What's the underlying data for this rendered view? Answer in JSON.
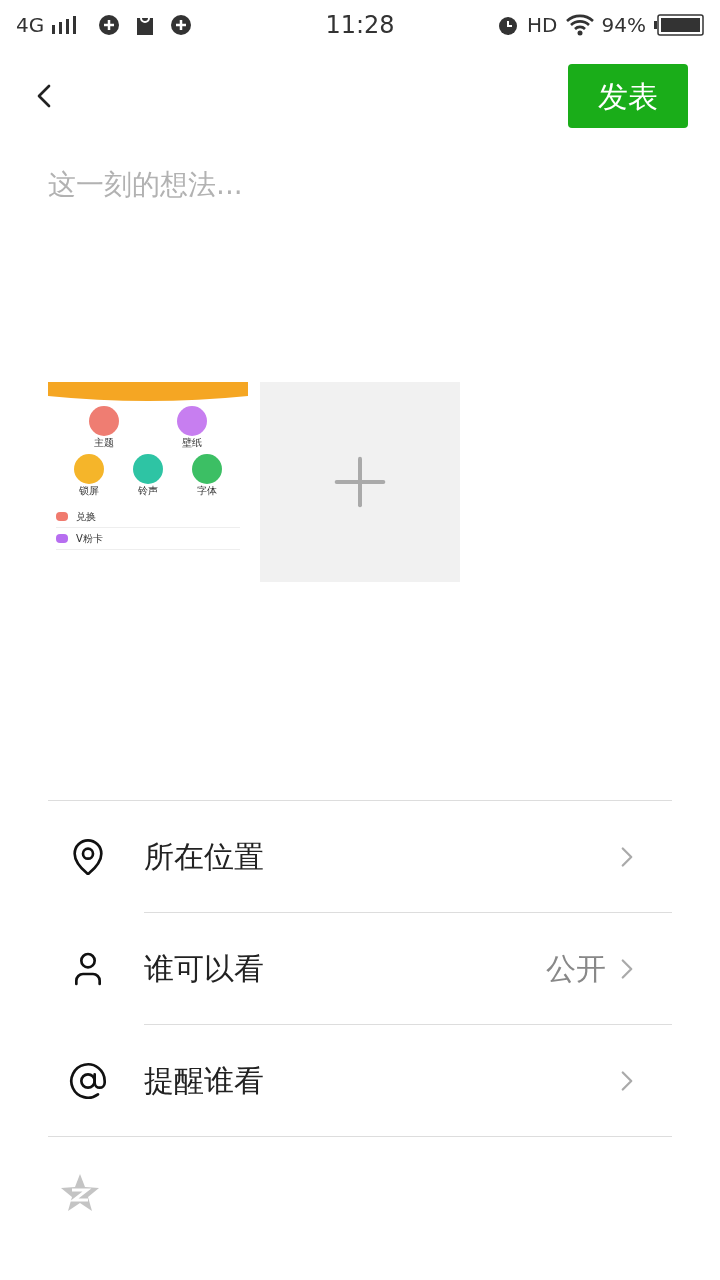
{
  "status_bar": {
    "network": "4G",
    "time": "11:28",
    "hd": "HD",
    "battery": "94%"
  },
  "header": {
    "publish_button": "发表"
  },
  "post": {
    "placeholder": "这一刻的想法..."
  },
  "photos": [
    {
      "kind": "screenshot",
      "grid_rows": [
        [
          {
            "label": "主题",
            "color": "#ef7d72"
          },
          {
            "label": "壁纸",
            "color": "#c77ef0"
          }
        ],
        [
          {
            "label": "锁屏",
            "color": "#f5b52a"
          },
          {
            "label": "铃声",
            "color": "#2ec4a4"
          },
          {
            "label": "字体",
            "color": "#3cbf64"
          }
        ]
      ],
      "list_items": [
        {
          "label": "兑换",
          "color": "#f07a6e"
        },
        {
          "label": "V粉卡",
          "color": "#b76ef0"
        }
      ]
    },
    {
      "kind": "add"
    }
  ],
  "options": [
    {
      "kind": "location",
      "label": "所在位置"
    },
    {
      "kind": "visibility",
      "label": "谁可以看",
      "value": "公开"
    },
    {
      "kind": "mention",
      "label": "提醒谁看"
    }
  ]
}
